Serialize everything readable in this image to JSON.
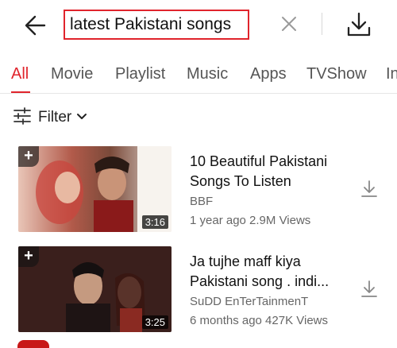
{
  "search": {
    "query": "latest Pakistani songs"
  },
  "tabs": [
    {
      "label": "All"
    },
    {
      "label": "Movie"
    },
    {
      "label": "Playlist"
    },
    {
      "label": "Music"
    },
    {
      "label": "Apps"
    },
    {
      "label": "TVShow"
    },
    {
      "label": "In"
    }
  ],
  "filter": {
    "label": "Filter"
  },
  "results": [
    {
      "title_line1": "10 Beautiful Pakistani",
      "title_line2": "Songs To Listen",
      "channel": "BBF",
      "meta": "1 year ago 2.9M Views",
      "duration": "3:16"
    },
    {
      "title_line1": "Ja tujhe maff kiya",
      "title_line2": "Pakistani song . indi...",
      "channel": "SuDD EnTerTainmenT",
      "meta": "6 months ago 427K Views",
      "duration": "3:25"
    }
  ],
  "colors": {
    "accent": "#e0242c",
    "text": "#111111",
    "secondary": "#666666"
  },
  "icons": [
    "back-arrow-icon",
    "clear-icon",
    "download-icon",
    "filter-sliders-icon",
    "chevron-down-icon",
    "plus-icon"
  ]
}
